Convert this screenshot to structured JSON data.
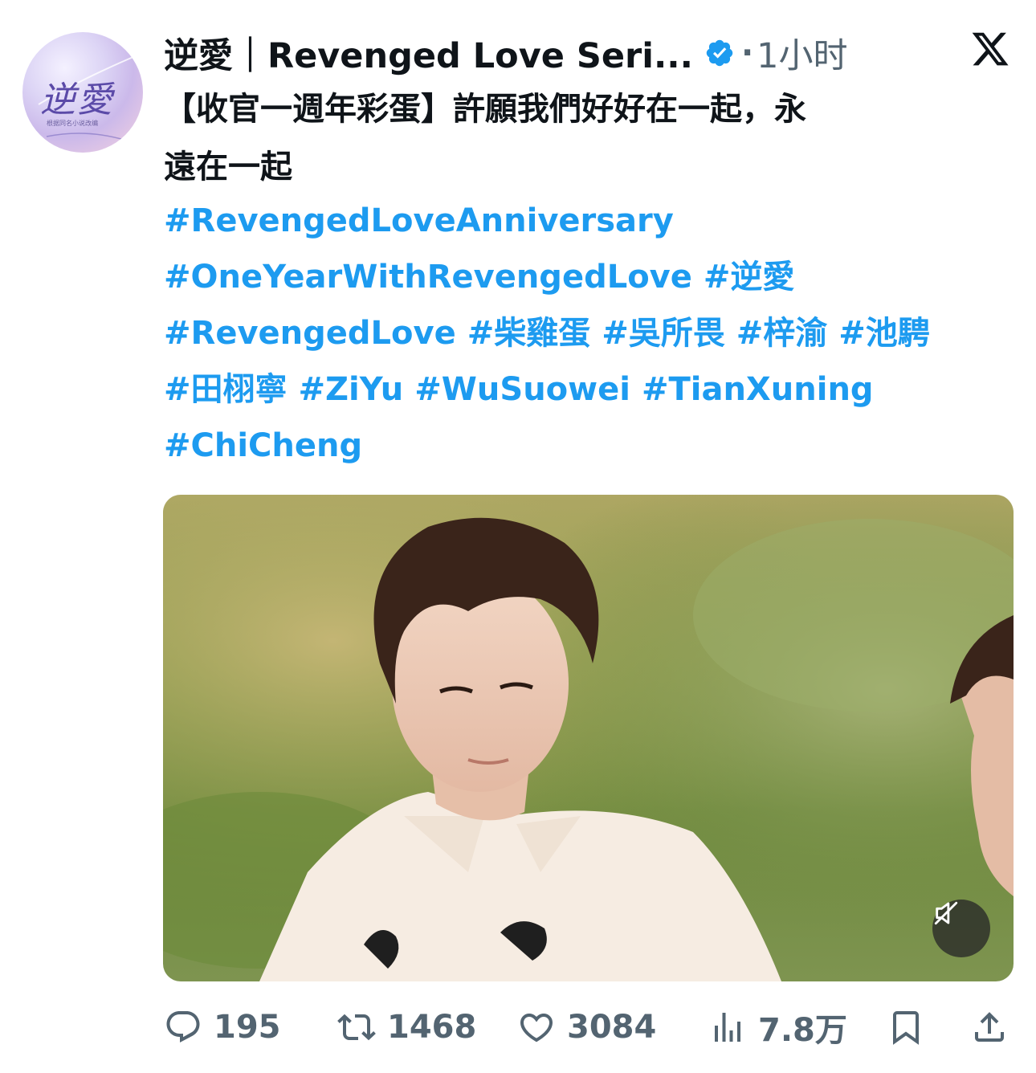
{
  "author": {
    "name": "逆愛｜Revenged Love Seri...",
    "verified": true,
    "time": "1小时",
    "avatar_logo": "逆愛",
    "avatar_subtitle": "根据同名小说改编"
  },
  "tweet": {
    "line1": "【收官一週年彩蛋】許願我們好好在一起，永",
    "line2": "遠在一起"
  },
  "hashtags": [
    "#RevengedLoveAnniversary",
    "#OneYearWithRevengedLove",
    "#逆愛",
    "#RevengedLove",
    "#柴雞蛋",
    "#吳所畏",
    "#梓渝",
    "#池騁",
    "#田栩寧",
    "#ZiYu",
    "#WuSuowei",
    "#TianXuning",
    "#ChiCheng"
  ],
  "media": {
    "type": "video",
    "muted": true
  },
  "actions": {
    "replies": "195",
    "reposts": "1468",
    "likes": "3084",
    "views": "7.8万"
  },
  "colors": {
    "link": "#1d9bf0",
    "muted_text": "#536471",
    "verified": "#1d9bf0"
  }
}
